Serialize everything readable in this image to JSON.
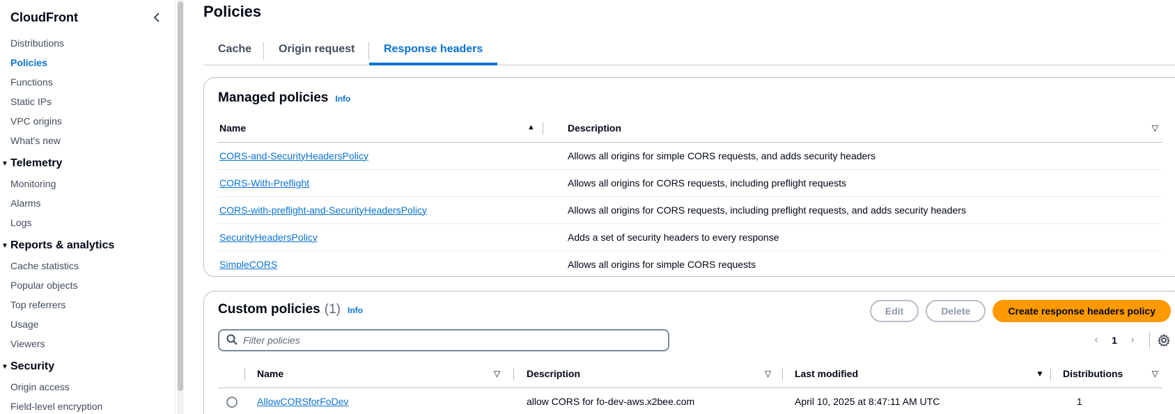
{
  "sidebar": {
    "title": "CloudFront",
    "top_items": [
      {
        "label": "Distributions",
        "active": false
      },
      {
        "label": "Policies",
        "active": true
      },
      {
        "label": "Functions",
        "active": false
      },
      {
        "label": "Static IPs",
        "active": false
      },
      {
        "label": "VPC origins",
        "active": false
      },
      {
        "label": "What's new",
        "active": false
      }
    ],
    "sections": [
      {
        "label": "Telemetry",
        "items": [
          "Monitoring",
          "Alarms",
          "Logs"
        ]
      },
      {
        "label": "Reports & analytics",
        "items": [
          "Cache statistics",
          "Popular objects",
          "Top referrers",
          "Usage",
          "Viewers"
        ]
      },
      {
        "label": "Security",
        "items": [
          "Origin access",
          "Field-level encryption"
        ]
      }
    ]
  },
  "page": {
    "title": "Policies",
    "tabs": [
      {
        "label": "Cache",
        "active": false
      },
      {
        "label": "Origin request",
        "active": false
      },
      {
        "label": "Response headers",
        "active": true
      }
    ]
  },
  "managed": {
    "title": "Managed policies",
    "info": "Info",
    "columns": [
      "Name",
      "Description"
    ],
    "rows": [
      {
        "name": "CORS-and-SecurityHeadersPolicy",
        "description": "Allows all origins for simple CORS requests, and adds security headers"
      },
      {
        "name": "CORS-With-Preflight",
        "description": "Allows all origins for CORS requests, including preflight requests"
      },
      {
        "name": "CORS-with-preflight-and-SecurityHeadersPolicy",
        "description": "Allows all origins for CORS requests, including preflight requests, and adds security headers"
      },
      {
        "name": "SecurityHeadersPolicy",
        "description": "Adds a set of security headers to every response"
      },
      {
        "name": "SimpleCORS",
        "description": "Allows all origins for simple CORS requests"
      }
    ]
  },
  "custom": {
    "title": "Custom policies",
    "count": "(1)",
    "info": "Info",
    "edit_label": "Edit",
    "delete_label": "Delete",
    "create_label": "Create response headers policy",
    "filter_placeholder": "Filter policies",
    "page_number": "1",
    "columns": [
      "Name",
      "Description",
      "Last modified",
      "Distributions"
    ],
    "rows": [
      {
        "name": "AllowCORSforFoDev",
        "description": "allow CORS for fo-dev-aws.x2bee.com",
        "last_modified": "April 10, 2025 at 8:47:11 AM UTC",
        "distributions": "1"
      }
    ]
  },
  "colors": {
    "link": "#0972d3",
    "primary_button": "#ff9900",
    "border": "#b6bec9"
  }
}
